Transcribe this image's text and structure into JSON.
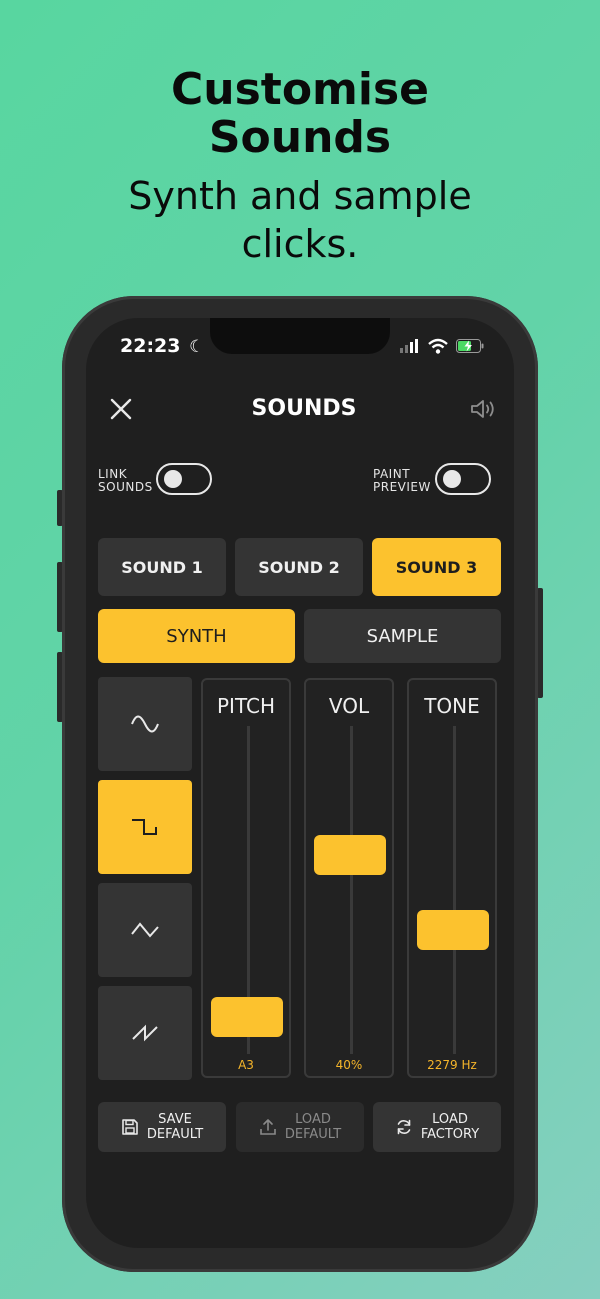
{
  "headline": {
    "title_line1": "Customise",
    "title_line2": "Sounds",
    "subtitle_line1": "Synth and sample",
    "subtitle_line2": "clicks."
  },
  "status_bar": {
    "time": "22:23"
  },
  "header": {
    "title": "SOUNDS"
  },
  "toggles": {
    "link_sounds": {
      "line1": "LINK",
      "line2": "SOUNDS",
      "on": false
    },
    "paint_preview": {
      "line1": "PAINT",
      "line2": "PREVIEW",
      "on": false
    }
  },
  "sound_tabs": [
    {
      "label": "SOUND 1",
      "active": false
    },
    {
      "label": "SOUND 2",
      "active": false
    },
    {
      "label": "SOUND 3",
      "active": true
    }
  ],
  "modes": [
    {
      "label": "SYNTH",
      "active": true
    },
    {
      "label": "SAMPLE",
      "active": false
    }
  ],
  "waveforms": [
    {
      "icon": "sine-wave-icon",
      "active": false
    },
    {
      "icon": "square-wave-icon",
      "active": true
    },
    {
      "icon": "triangle-wave-icon",
      "active": false
    },
    {
      "icon": "sawtooth-wave-icon",
      "active": false
    }
  ],
  "sliders": [
    {
      "label": "PITCH",
      "value_text": "A3",
      "level": 0.06
    },
    {
      "label": "VOL",
      "value_text": "40%",
      "level": 0.62
    },
    {
      "label": "TONE",
      "value_text": "2279 Hz",
      "level": 0.36
    }
  ],
  "actions": {
    "save_default": {
      "line1": "SAVE",
      "line2": "DEFAULT",
      "enabled": true
    },
    "load_default": {
      "line1": "LOAD",
      "line2": "DEFAULT",
      "enabled": false
    },
    "load_factory": {
      "line1": "LOAD",
      "line2": "FACTORY",
      "enabled": true
    }
  },
  "colors": {
    "accent": "#fcc22e",
    "panel": "#343434",
    "screen": "#1f1f1f"
  }
}
